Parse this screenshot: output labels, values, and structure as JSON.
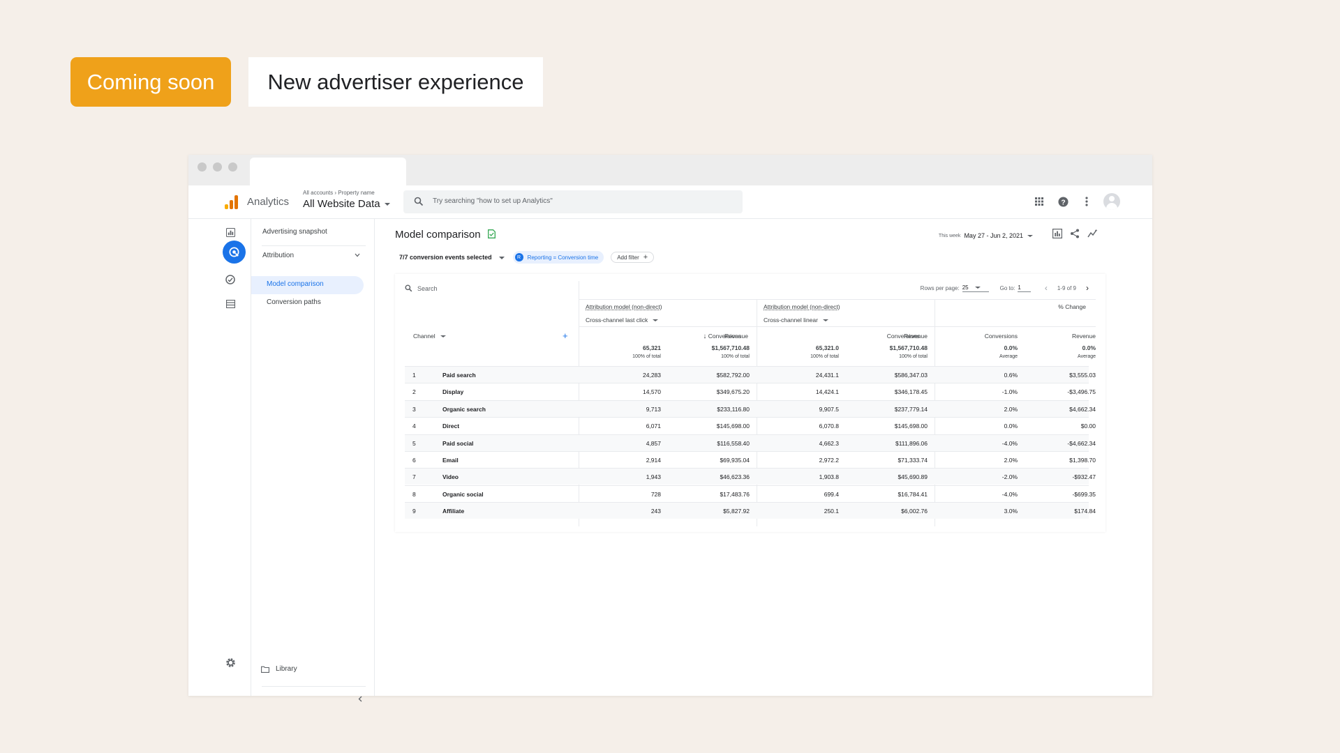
{
  "promo": {
    "coming_soon": "Coming soon",
    "headline": "New advertiser experience"
  },
  "header": {
    "app_name": "Analytics",
    "breadcrumb_accounts": "All accounts",
    "breadcrumb_property": "Property name",
    "property_selected": "All Website Data",
    "search_placeholder": "Try searching \"how to set up Analytics\""
  },
  "nav": {
    "advertising_snapshot": "Advertising snapshot",
    "attribution": "Attribution",
    "model_comparison": "Model comparison",
    "conversion_paths": "Conversion paths",
    "library": "Library"
  },
  "page": {
    "title": "Model comparison",
    "events_selected": "7/7 conversion events selected",
    "chip_letter": "R",
    "chip_label": "Reporting = Conversion time",
    "add_filter": "Add filter",
    "date_prefix": "This week",
    "date_range": "May 27 - Jun 2, 2021"
  },
  "table": {
    "search_placeholder": "Search",
    "rows_per_page_label": "Rows per page:",
    "rows_per_page": "25",
    "goto_label": "Go to:",
    "goto_value": "1",
    "page_range": "1-9 of 9",
    "group_a_title": "Attribution model (non-direct)",
    "group_a_model": "Cross-channel last click",
    "group_b_title": "Attribution model (non-direct)",
    "group_b_model": "Cross-channel linear",
    "group_c_title": "% Change",
    "dimension": "Channel",
    "col_conversions": "Conversions",
    "col_revenue": "Revenue",
    "totals": {
      "a_conv": "65,321",
      "a_conv_sub": "100% of total",
      "a_rev": "$1,567,710.48",
      "a_rev_sub": "100% of total",
      "b_conv": "65,321.0",
      "b_conv_sub": "100% of total",
      "b_rev": "$1,567,710.48",
      "b_rev_sub": "100% of total",
      "c_conv": "0.0%",
      "c_conv_sub": "Average",
      "c_rev": "0.0%",
      "c_rev_sub": "Average"
    },
    "rows": [
      {
        "n": "1",
        "channel": "Paid search",
        "a_conv": "24,283",
        "a_rev": "$582,792.00",
        "b_conv": "24,431.1",
        "b_rev": "$586,347.03",
        "c_conv": "0.6%",
        "c_rev": "$3,555.03"
      },
      {
        "n": "2",
        "channel": "Display",
        "a_conv": "14,570",
        "a_rev": "$349,675.20",
        "b_conv": "14,424.1",
        "b_rev": "$346,178.45",
        "c_conv": "-1.0%",
        "c_rev": "-$3,496.75"
      },
      {
        "n": "3",
        "channel": "Organic search",
        "a_conv": "9,713",
        "a_rev": "$233,116.80",
        "b_conv": "9,907.5",
        "b_rev": "$237,779.14",
        "c_conv": "2.0%",
        "c_rev": "$4,662.34"
      },
      {
        "n": "4",
        "channel": "Direct",
        "a_conv": "6,071",
        "a_rev": "$145,698.00",
        "b_conv": "6,070.8",
        "b_rev": "$145,698.00",
        "c_conv": "0.0%",
        "c_rev": "$0.00"
      },
      {
        "n": "5",
        "channel": "Paid social",
        "a_conv": "4,857",
        "a_rev": "$116,558.40",
        "b_conv": "4,662.3",
        "b_rev": "$111,896.06",
        "c_conv": "-4.0%",
        "c_rev": "-$4,662.34"
      },
      {
        "n": "6",
        "channel": "Email",
        "a_conv": "2,914",
        "a_rev": "$69,935.04",
        "b_conv": "2,972.2",
        "b_rev": "$71,333.74",
        "c_conv": "2.0%",
        "c_rev": "$1,398.70"
      },
      {
        "n": "7",
        "channel": "Video",
        "a_conv": "1,943",
        "a_rev": "$46,623.36",
        "b_conv": "1,903.8",
        "b_rev": "$45,690.89",
        "c_conv": "-2.0%",
        "c_rev": "-$932.47"
      },
      {
        "n": "8",
        "channel": "Organic social",
        "a_conv": "728",
        "a_rev": "$17,483.76",
        "b_conv": "699.4",
        "b_rev": "$16,784.41",
        "c_conv": "-4.0%",
        "c_rev": "-$699.35"
      },
      {
        "n": "9",
        "channel": "Affiliate",
        "a_conv": "243",
        "a_rev": "$5,827.92",
        "b_conv": "250.1",
        "b_rev": "$6,002.76",
        "c_conv": "3.0%",
        "c_rev": "$174.84"
      }
    ]
  },
  "colors": {
    "accent": "#1a73e8",
    "promo_orange": "#efa11a",
    "background": "#f5efe9"
  }
}
